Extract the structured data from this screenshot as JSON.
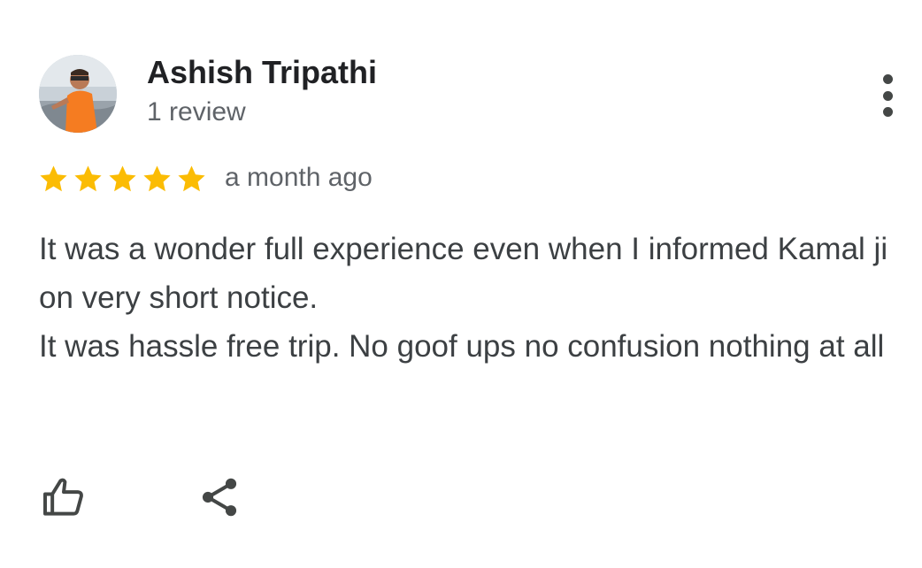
{
  "review": {
    "author_name": "Ashish Tripathi",
    "author_meta": "1 review",
    "rating": 5,
    "rating_max": 5,
    "time_ago": "a month ago",
    "text_lines": [
      "It was a wonder full experience even when I informed Kamal ji on very short notice.",
      "It was hassle free trip. No goof ups no confusion nothing at all"
    ]
  },
  "icons": {
    "avatar": "avatar-photo",
    "more": "more-vert-icon",
    "star": "star-icon",
    "like": "thumb-up-icon",
    "share": "share-icon"
  },
  "colors": {
    "star": "#fbbc04",
    "name": "#202124",
    "secondary": "#5f6368",
    "body": "#3c4043",
    "icon": "#444746"
  }
}
